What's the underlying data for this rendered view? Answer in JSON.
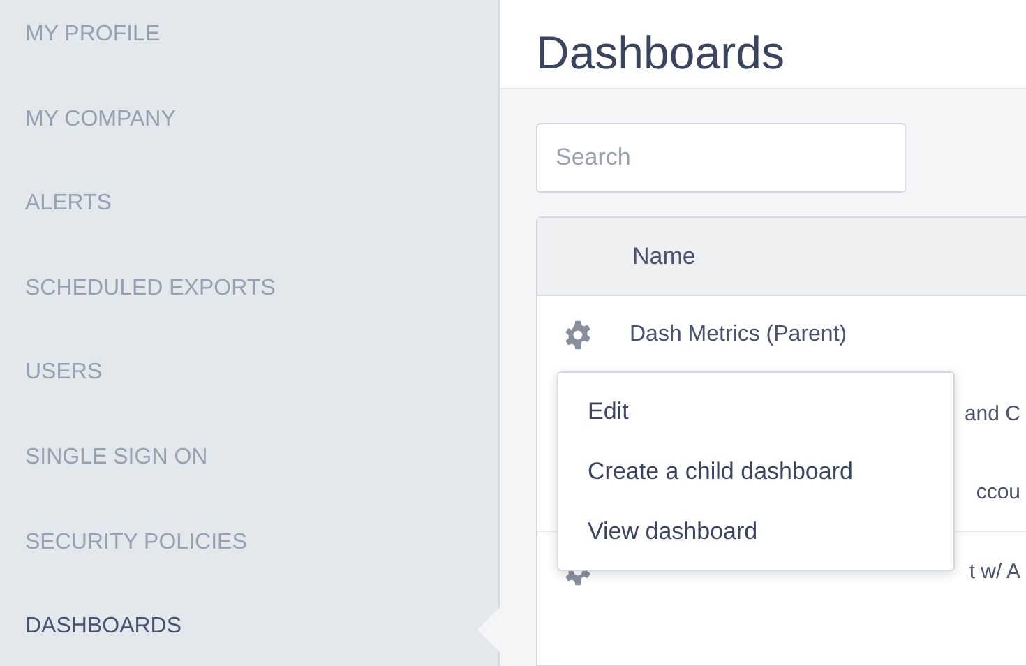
{
  "sidebar": {
    "items": [
      {
        "label": "MY PROFILE",
        "selected": false
      },
      {
        "label": "MY COMPANY",
        "selected": false
      },
      {
        "label": "ALERTS",
        "selected": false
      },
      {
        "label": "SCHEDULED EXPORTS",
        "selected": false
      },
      {
        "label": "USERS",
        "selected": false
      },
      {
        "label": "SINGLE SIGN ON",
        "selected": false
      },
      {
        "label": "SECURITY POLICIES",
        "selected": false
      },
      {
        "label": "DASHBOARDS",
        "selected": true
      }
    ]
  },
  "page": {
    "title": "Dashboards"
  },
  "search": {
    "placeholder": "Search"
  },
  "table": {
    "columns": [
      "Name"
    ],
    "rows": [
      {
        "name": "Dash Metrics (Parent)",
        "gear": true,
        "kind": "full"
      },
      {
        "name": "and C",
        "kind": "partial"
      },
      {
        "name": "ccou",
        "kind": "partial"
      },
      {
        "name": "t w/ A",
        "gear": true,
        "kind": "partial"
      }
    ]
  },
  "menu": {
    "items": [
      "Edit",
      "Create a child dashboard",
      "View dashboard"
    ]
  }
}
